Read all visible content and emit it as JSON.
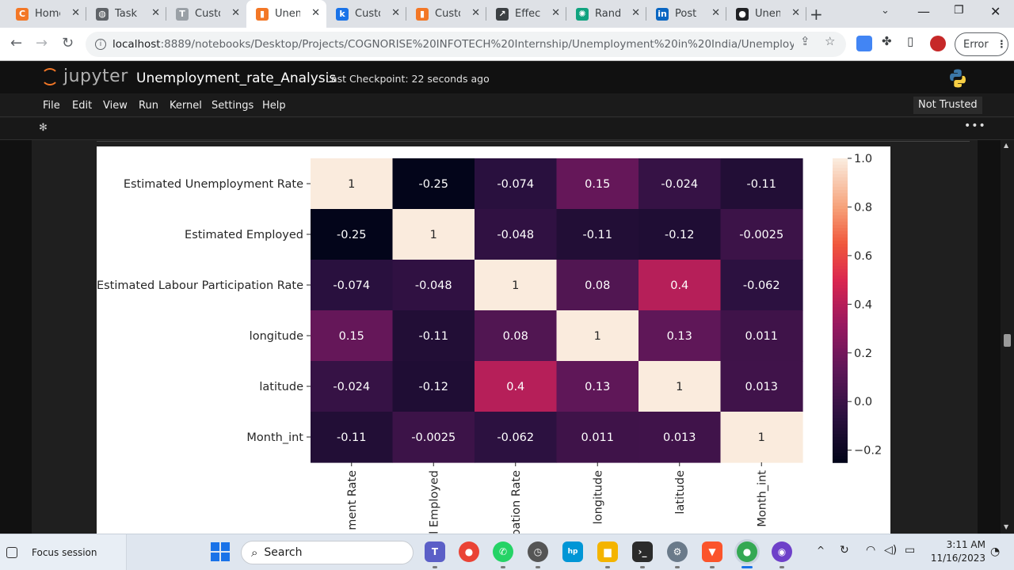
{
  "browser": {
    "tabs": [
      {
        "label": "Home",
        "fav_color": "#f37726",
        "fav_glyph": "C"
      },
      {
        "label": "Task L",
        "fav_color": "#5f6368",
        "fav_glyph": "◍"
      },
      {
        "label": "Custo",
        "fav_color": "#9aa0a6",
        "fav_glyph": "T"
      },
      {
        "label": "Unem",
        "fav_color": "#f37726",
        "fav_glyph": "▮"
      },
      {
        "label": "Custo",
        "fav_color": "#1a73e8",
        "fav_glyph": "k"
      },
      {
        "label": "Custo",
        "fav_color": "#f37726",
        "fav_glyph": "▮"
      },
      {
        "label": "Effecti",
        "fav_color": "#3c4043",
        "fav_glyph": "↗"
      },
      {
        "label": "Rando",
        "fav_color": "#10a37f",
        "fav_glyph": "✺"
      },
      {
        "label": "Post |",
        "fav_color": "#0a66c2",
        "fav_glyph": "in"
      },
      {
        "label": "Unem",
        "fav_color": "#202124",
        "fav_glyph": "●"
      }
    ],
    "url_host": "localhost",
    "url_path": ":8889/notebooks/Desktop/Projects/COGNORISE%20INFOTECH%20Internship/Unemployment%20in%20India/Unemployment_r...",
    "error_label": "Error"
  },
  "jupyter": {
    "logo_text": "jupyter",
    "notebook_title": "Unemployment_rate_Analysis",
    "checkpoint": "Last Checkpoint: 22 seconds ago",
    "menu": [
      "File",
      "Edit",
      "View",
      "Run",
      "Kernel",
      "Settings",
      "Help"
    ],
    "trust_status": "Not Trusted"
  },
  "chart_data": {
    "type": "heatmap",
    "rows": [
      "Estimated Unemployment Rate",
      "Estimated Employed",
      "Estimated Labour Participation Rate",
      "longitude",
      "latitude",
      "Month_int"
    ],
    "columns": [
      "ment Rate",
      "l Employed",
      "oation Rate",
      "longitude",
      "latitude",
      "Month_int"
    ],
    "values": [
      [
        1,
        -0.25,
        -0.074,
        0.15,
        -0.024,
        -0.11
      ],
      [
        -0.25,
        1,
        -0.048,
        -0.11,
        -0.12,
        -0.0025
      ],
      [
        -0.074,
        -0.048,
        1,
        0.08,
        0.4,
        -0.062
      ],
      [
        0.15,
        -0.11,
        0.08,
        1,
        0.13,
        0.011
      ],
      [
        -0.024,
        -0.12,
        0.4,
        0.13,
        1,
        0.013
      ],
      [
        -0.11,
        -0.0025,
        -0.062,
        0.011,
        0.013,
        1
      ]
    ],
    "value_labels": [
      [
        "1",
        "-0.25",
        "-0.074",
        "0.15",
        "-0.024",
        "-0.11"
      ],
      [
        "-0.25",
        "1",
        "-0.048",
        "-0.11",
        "-0.12",
        "-0.0025"
      ],
      [
        "-0.074",
        "-0.048",
        "1",
        "0.08",
        "0.4",
        "-0.062"
      ],
      [
        "0.15",
        "-0.11",
        "0.08",
        "1",
        "0.13",
        "0.011"
      ],
      [
        "-0.024",
        "-0.12",
        "0.4",
        "0.13",
        "1",
        "0.013"
      ],
      [
        "-0.11",
        "-0.0025",
        "-0.062",
        "0.011",
        "0.013",
        "1"
      ]
    ],
    "color_range": [
      -0.25,
      1.0
    ],
    "colorbar_ticks": [
      "1.0",
      "0.8",
      "0.6",
      "0.4",
      "0.2",
      "0.0",
      "−0.2"
    ],
    "colorbar_tick_values": [
      1.0,
      0.8,
      0.6,
      0.4,
      0.2,
      0.0,
      -0.2
    ],
    "colormap": "rocket"
  },
  "taskbar": {
    "focus_label": "Focus session",
    "search_placeholder": "Search",
    "time": "3:11 AM",
    "date": "11/16/2023"
  }
}
